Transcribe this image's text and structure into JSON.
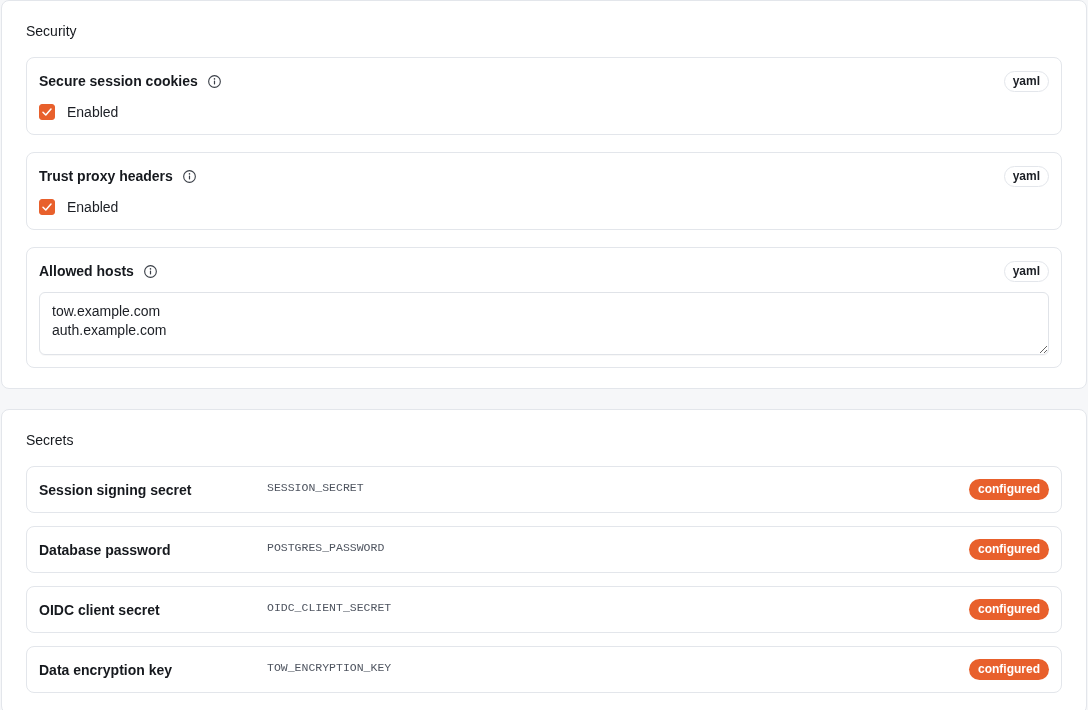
{
  "sections": [
    {
      "kind": "settings",
      "title": "Security",
      "fields": [
        {
          "kind": "checkbox",
          "label": "Secure session cookies",
          "format": "yaml",
          "checked": true,
          "option_label": "Enabled"
        },
        {
          "kind": "checkbox",
          "label": "Trust proxy headers",
          "format": "yaml",
          "checked": true,
          "option_label": "Enabled"
        },
        {
          "kind": "textarea",
          "label": "Allowed hosts",
          "format": "yaml",
          "value": "tow.example.com\nauth.example.com"
        }
      ]
    },
    {
      "kind": "secrets",
      "title": "Secrets",
      "rows": [
        {
          "label": "Session signing secret",
          "env_var": "SESSION_SECRET",
          "status": "configured"
        },
        {
          "label": "Database password",
          "env_var": "POSTGRES_PASSWORD",
          "status": "configured"
        },
        {
          "label": "OIDC client secret",
          "env_var": "OIDC_CLIENT_SECRET",
          "status": "configured"
        },
        {
          "label": "Data encryption key",
          "env_var": "TOW_ENCRYPTION_KEY",
          "status": "configured"
        }
      ]
    }
  ]
}
